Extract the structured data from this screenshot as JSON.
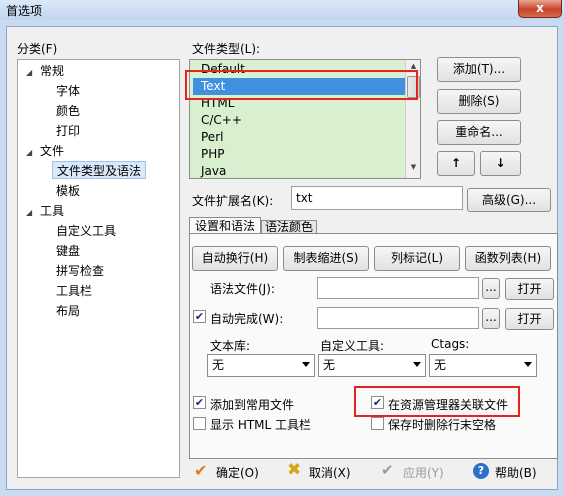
{
  "window": {
    "title": "首选项",
    "close_glyph": "x"
  },
  "category": {
    "label": "分类(F)",
    "items": [
      {
        "label": "常规",
        "level": 0,
        "expanded": true
      },
      {
        "label": "字体",
        "level": 1
      },
      {
        "label": "颜色",
        "level": 1
      },
      {
        "label": "打印",
        "level": 1
      },
      {
        "label": "文件",
        "level": 0,
        "expanded": true
      },
      {
        "label": "文件类型及语法",
        "level": 1,
        "selected": true
      },
      {
        "label": "模板",
        "level": 1
      },
      {
        "label": "工具",
        "level": 0,
        "expanded": true
      },
      {
        "label": "自定义工具",
        "level": 1
      },
      {
        "label": "键盘",
        "level": 1
      },
      {
        "label": "拼写检查",
        "level": 1
      },
      {
        "label": "工具栏",
        "level": 1
      },
      {
        "label": "布局",
        "level": 1
      }
    ]
  },
  "file_types": {
    "label": "文件类型(L):",
    "items": [
      "Default",
      "Text",
      "HTML",
      "C/C++",
      "Perl",
      "PHP",
      "Java"
    ],
    "selected": "Text"
  },
  "buttons": {
    "add": "添加(T)...",
    "delete": "删除(S)",
    "rename": "重命名...",
    "up": "↑",
    "down": "↓",
    "advanced": "高级(G)..."
  },
  "extension": {
    "label": "文件扩展名(K):",
    "value": "txt"
  },
  "tabs": [
    {
      "label": "设置和语法",
      "active": true
    },
    {
      "label": "语法颜色",
      "active": false
    }
  ],
  "settings": {
    "auto_wrap": "自动换行(H)",
    "tab_indent": "制表缩进(S)",
    "column_marker": "列标记(L)",
    "function_list": "函数列表(H)",
    "syntax_file_label": "语法文件(J):",
    "syntax_file_value": "",
    "browse": "...",
    "open": "打开",
    "autocomplete_label": "自动完成(W):",
    "autocomplete_checked": true,
    "autocomplete_value": "",
    "library_label": "文本库:",
    "library_value": "无",
    "custom_tool_label": "自定义工具:",
    "custom_tool_value": "无",
    "ctags_label": "Ctags:",
    "ctags_value": "无",
    "add_common": "添加到常用文件",
    "add_common_checked": true,
    "associate_explorer": "在资源管理器关联文件",
    "associate_explorer_checked": true,
    "show_html_toolbar": "显示 HTML 工具栏",
    "show_html_toolbar_checked": false,
    "trim_trailing": "保存时删除行末空格",
    "trim_trailing_checked": false
  },
  "footer": {
    "ok": "确定(O)",
    "cancel": "取消(X)",
    "apply": "应用(Y)",
    "help": "帮助(B)"
  },
  "colors": {
    "highlight_box": "#e0261d",
    "list_bg": "#d8f0d0",
    "selection": "#3f91e0"
  }
}
